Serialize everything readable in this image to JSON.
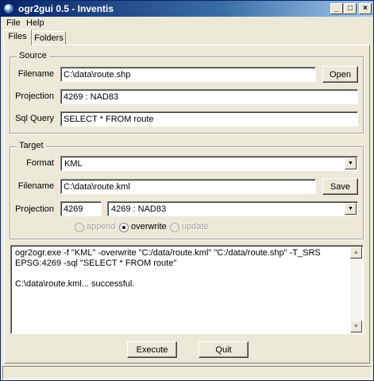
{
  "window": {
    "title": "ogr2gui 0.5 - Inventis"
  },
  "titlebar_buttons": {
    "minimize": "_",
    "maximize": "□",
    "close": "×"
  },
  "menu": {
    "file": "File",
    "help": "Help"
  },
  "tabs": {
    "files": "Files",
    "folders": "Folders"
  },
  "source": {
    "legend": "Source",
    "filename_label": "Filename",
    "filename_value": "C:\\data\\route.shp",
    "open_button": "Open",
    "projection_label": "Projection",
    "projection_value": "4269 : NAD83",
    "sql_label": "Sql Query",
    "sql_value": "SELECT * FROM route"
  },
  "target": {
    "legend": "Target",
    "format_label": "Format",
    "format_value": "KML",
    "filename_label": "Filename",
    "filename_value": "C:\\data\\route.kml",
    "save_button": "Save",
    "projection_label": "Projection",
    "epsg_value": "4269",
    "projection_value": "4269 : NAD83",
    "modes": {
      "append": "append",
      "overwrite": "overwrite",
      "update": "update"
    }
  },
  "output": {
    "text": "ogr2ogr.exe -f \"KML\" -overwrite \"C:/data/route.kml\" \"C:/data/route.shp\" -T_SRS EPSG:4269 -sql \"SELECT * FROM route\"\n\nC:\\data\\route.kml... successful."
  },
  "buttons": {
    "execute": "Execute",
    "quit": "Quit"
  },
  "icons": {
    "dropdown": "▼",
    "scroll_up": "▲",
    "scroll_down": "▼"
  }
}
